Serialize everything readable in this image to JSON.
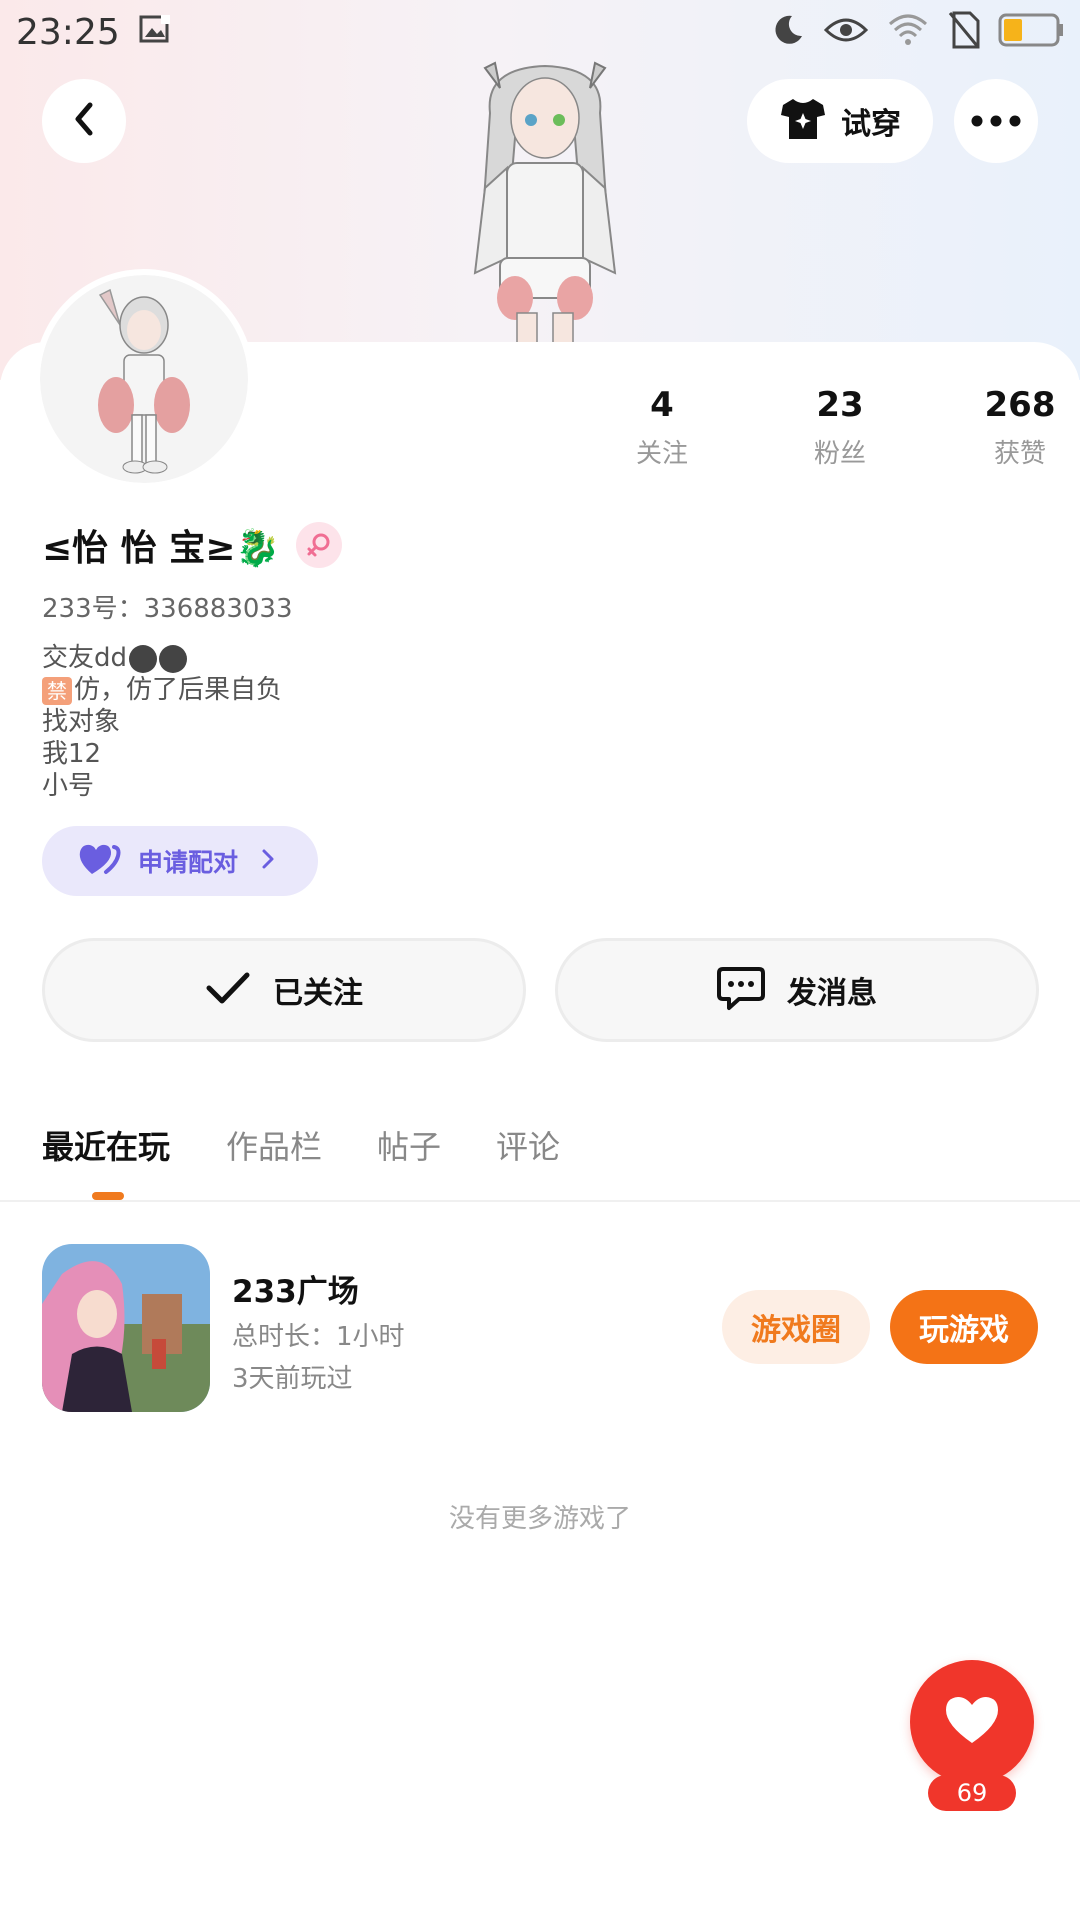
{
  "status_bar": {
    "time": "23:25"
  },
  "header": {
    "tryon_label": "试穿"
  },
  "profile": {
    "name": "≤怡 怡 宝≥🐉",
    "uid": "233号：336883033",
    "bio": {
      "line1": "交友dd",
      "line2_mark": "禁",
      "line2": "仿，仿了后果自负",
      "line3": "找对象",
      "line4": "我12",
      "line5": "小号"
    }
  },
  "stats": [
    {
      "value": "4",
      "label": "关注"
    },
    {
      "value": "23",
      "label": "粉丝"
    },
    {
      "value": "268",
      "label": "获赞"
    }
  ],
  "actions": {
    "pair_label": "申请配对",
    "follow_label": "已关注",
    "message_label": "发消息"
  },
  "tabs": [
    "最近在玩",
    "作品栏",
    "帖子",
    "评论"
  ],
  "game": {
    "title": "233广场",
    "duration": "总时长：1小时",
    "last_played": "3天前玩过",
    "circle_label": "游戏圈",
    "play_label": "玩游戏"
  },
  "no_more_text": "没有更多游戏了",
  "like_count": "69",
  "colors": {
    "accent": "#f47316",
    "like": "#f0362b",
    "pair": "#6a5ee0"
  }
}
